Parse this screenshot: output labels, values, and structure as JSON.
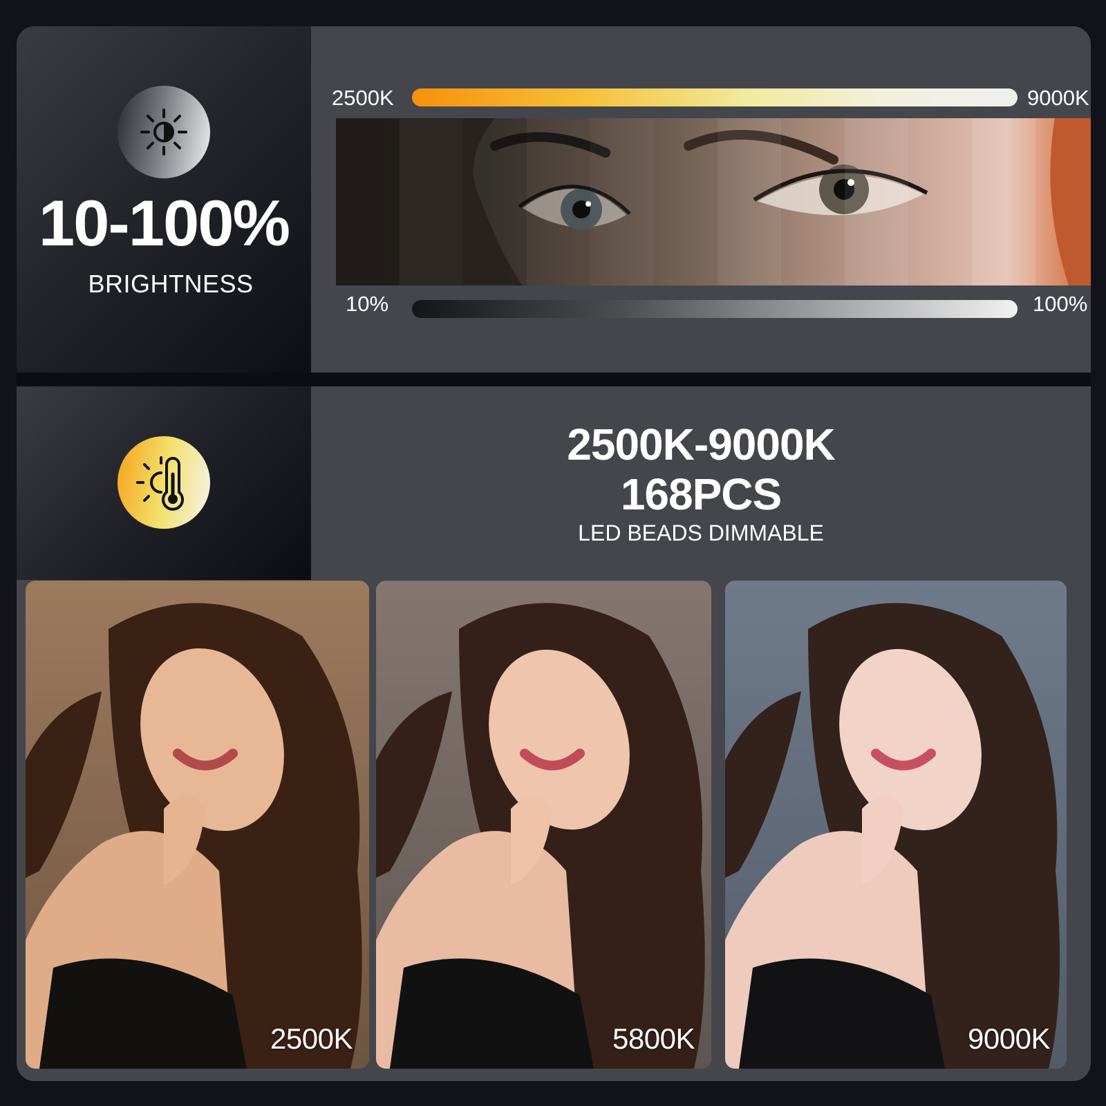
{
  "brightness": {
    "range_text": "10-100%",
    "label": "BRIGHTNESS",
    "icon": "sun-half-icon",
    "bar_min_label": "10%",
    "bar_max_label": "100%"
  },
  "color_temperature": {
    "bar_min_label": "2500K",
    "bar_max_label": "9000K",
    "icon": "thermometer-sun-icon"
  },
  "headline": {
    "line1": "2500K-9000K",
    "line2": "168PCS",
    "subtitle": "LED BEADS DIMMABLE"
  },
  "photos": [
    {
      "label": "2500K",
      "tint": "#8a6a52"
    },
    {
      "label": "5800K",
      "tint": "#7a6e6a"
    },
    {
      "label": "9000K",
      "tint": "#6a7484"
    }
  ],
  "colors": {
    "frame": "#45464c",
    "background": "#11121a",
    "warm_accent": "#f7900e",
    "text": "#ffffff"
  }
}
